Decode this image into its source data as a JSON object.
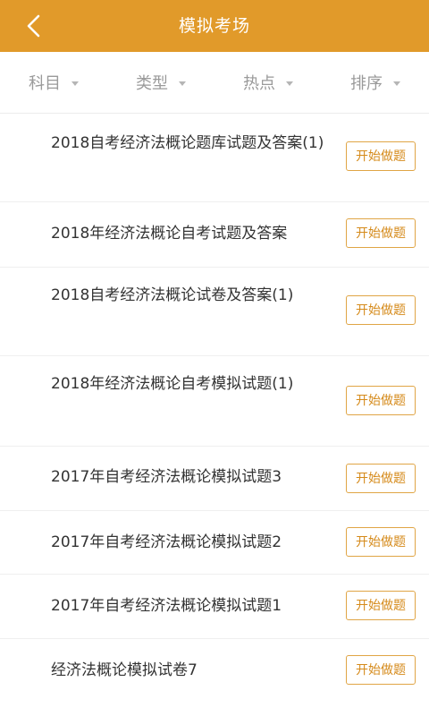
{
  "header": {
    "title": "模拟考场"
  },
  "filters": [
    {
      "label": "科目"
    },
    {
      "label": "类型"
    },
    {
      "label": "热点"
    },
    {
      "label": "排序"
    }
  ],
  "items": [
    {
      "title": "2018自考经济法概论题库试题及答案(1)",
      "button": "开始做题"
    },
    {
      "title": "2018年经济法概论自考试题及答案",
      "button": "开始做题"
    },
    {
      "title": "2018自考经济法概论试卷及答案(1)",
      "button": "开始做题"
    },
    {
      "title": "2018年经济法概论自考模拟试题(1)",
      "button": "开始做题"
    },
    {
      "title": "2017年自考经济法概论模拟试题3",
      "button": "开始做题"
    },
    {
      "title": "2017年自考经济法概论模拟试题2",
      "button": "开始做题"
    },
    {
      "title": "2017年自考经济法概论模拟试题1",
      "button": "开始做题"
    },
    {
      "title": "经济法概论模拟试卷7",
      "button": "开始做题"
    }
  ],
  "colors": {
    "header_bg": "#E19A2A",
    "button_border": "#E0A545",
    "button_text": "#D58A1A",
    "filter_text": "#9a9a9a",
    "item_text": "#333333"
  }
}
